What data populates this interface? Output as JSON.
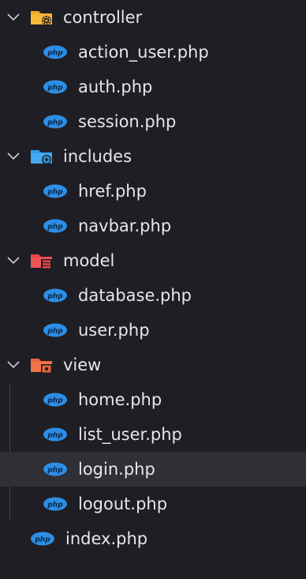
{
  "explorer": {
    "folders": {
      "controller": {
        "label": "controller",
        "icon": "settings-folder-icon",
        "color": "#f0a930"
      },
      "includes": {
        "label": "includes",
        "icon": "plus-folder-icon",
        "color": "#2f9be8"
      },
      "model": {
        "label": "model",
        "icon": "database-folder-icon",
        "color": "#e8464a"
      },
      "view": {
        "label": "view",
        "icon": "view-folder-icon",
        "color": "#e8643c"
      }
    },
    "files": {
      "action_user": "action_user.php",
      "auth": "auth.php",
      "session": "session.php",
      "href": "href.php",
      "navbar": "navbar.php",
      "database": "database.php",
      "user": "user.php",
      "home": "home.php",
      "list_user": "list_user.php",
      "login": "login.php",
      "logout": "logout.php",
      "index": "index.php"
    },
    "file_icon": "php-icon",
    "php_icon_color": "#2c8ee6",
    "selected_file": "login.php"
  }
}
